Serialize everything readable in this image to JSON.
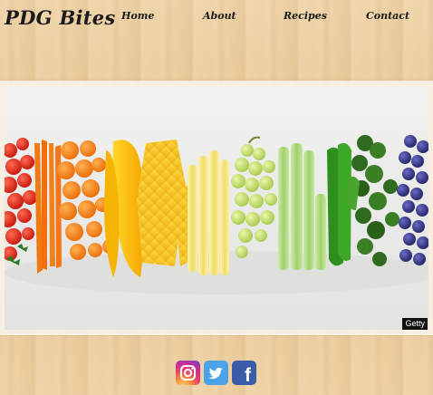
{
  "brand": {
    "name": "PDG Bites"
  },
  "nav": {
    "items": [
      {
        "label": "Home"
      },
      {
        "label": "About"
      },
      {
        "label": "Recipes"
      },
      {
        "label": "Contact"
      }
    ]
  },
  "hero": {
    "credit": "Getty"
  },
  "social": {
    "icons": [
      "instagram-icon",
      "twitter-icon",
      "facebook-icon"
    ],
    "facebook_glyph": "f"
  },
  "colors": {
    "background": "#e8c99b",
    "text": "#1a1a1a",
    "twitter": "#4aa3e6",
    "facebook": "#3b5ca8"
  }
}
